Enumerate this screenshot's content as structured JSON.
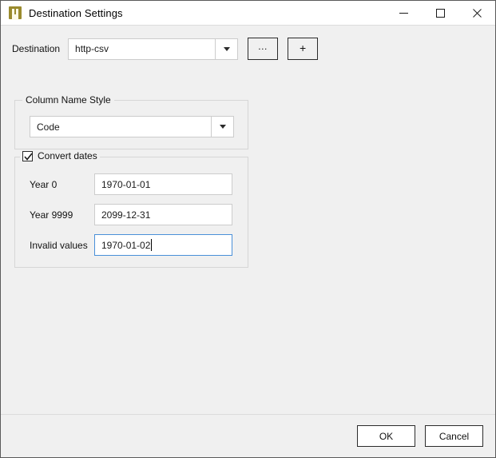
{
  "window": {
    "title": "Destination Settings",
    "icon": "app-u-icon",
    "icon_color": "#9a8b2e",
    "controls": {
      "minimize": "minimize-icon",
      "maximize": "maximize-icon",
      "close": "close-icon"
    }
  },
  "destination": {
    "label": "Destination",
    "combo_value": "http-csv",
    "browse_button": "...",
    "add_button": "+"
  },
  "column_name_style": {
    "group_title": "Column Name Style",
    "combo_value": "Code"
  },
  "convert_dates": {
    "group_title": "Convert dates",
    "checked": true,
    "fields": [
      {
        "label": "Year 0",
        "value": "1970-01-01",
        "focused": false
      },
      {
        "label": "Year 9999",
        "value": "2099-12-31",
        "focused": false
      },
      {
        "label": "Invalid values",
        "value": "1970-01-02",
        "focused": true
      }
    ]
  },
  "footer": {
    "ok_label": "OK",
    "cancel_label": "Cancel"
  },
  "colors": {
    "background": "#f0f0f0",
    "titlebar": "#ffffff",
    "focus_border": "#4a90d9",
    "field_border": "#cccccc",
    "button_border": "#2b2b2b"
  }
}
